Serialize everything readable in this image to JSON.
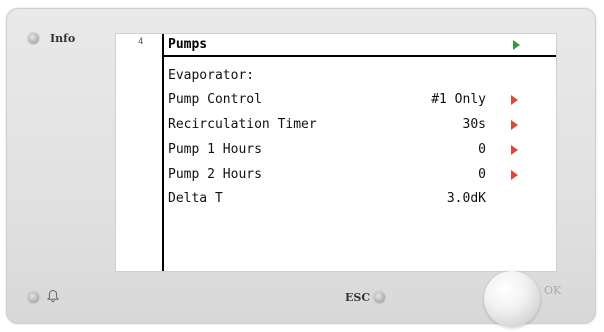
{
  "device": {
    "info_label": "Info",
    "esc_label": "ESC",
    "ok_label": "OK"
  },
  "screen": {
    "index": "4",
    "title": "Pumps",
    "section": "Evaporator:",
    "rows": [
      {
        "label": "Pump Control",
        "value": "#1 Only",
        "arrow": true
      },
      {
        "label": "Recirculation Timer",
        "value": "30s",
        "arrow": true
      },
      {
        "label": "Pump 1 Hours",
        "value": "0",
        "arrow": true
      },
      {
        "label": "Pump 2 Hours",
        "value": "0",
        "arrow": true
      },
      {
        "label": "Delta T",
        "value": "3.0dK",
        "arrow": false
      }
    ],
    "colors": {
      "nav_arrow": "#2e9e3a",
      "row_arrow": "#e0473a"
    }
  }
}
